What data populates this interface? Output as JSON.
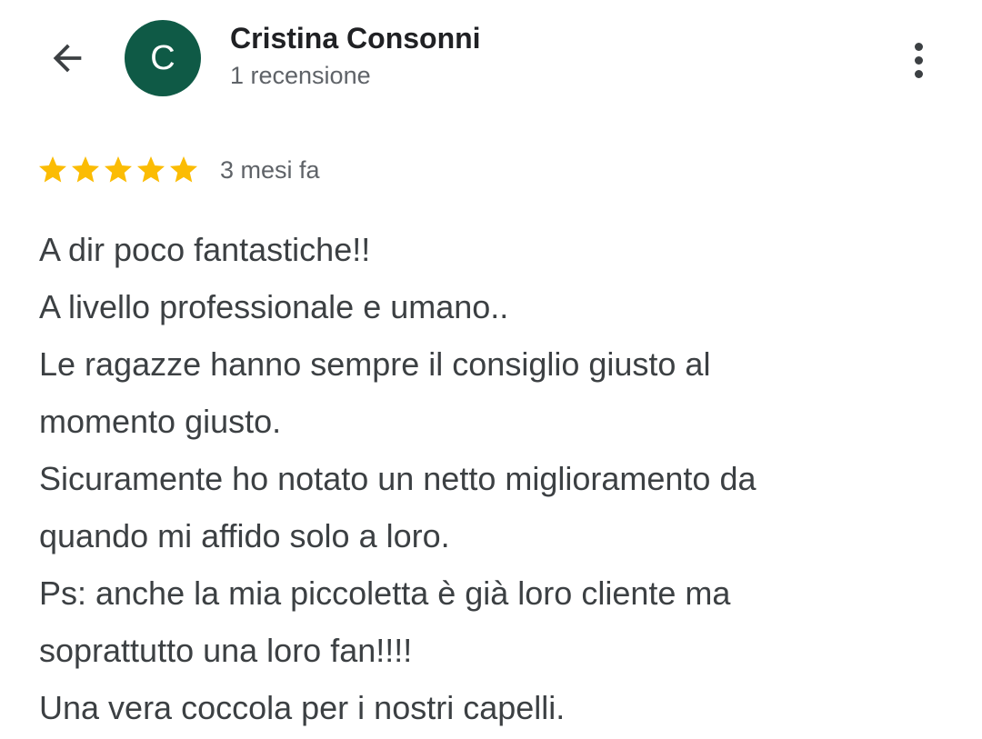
{
  "header": {
    "back_icon": "arrow-back-icon",
    "avatar": {
      "letter": "C",
      "color": "#0f5a46"
    },
    "name": "Cristina Consonni",
    "subtitle": "1 recensione",
    "more_icon": "more-vert-icon"
  },
  "rating": {
    "stars": 5,
    "max_stars": 5,
    "star_color": "#fbbc04",
    "time_ago": "3 mesi fa"
  },
  "review": {
    "lines": [
      "A dir poco fantastiche!!",
      "A livello professionale e umano..",
      "Le ragazze hanno sempre il consiglio giusto al",
      "momento giusto.",
      "Sicuramente ho notato un netto miglioramento da",
      "quando mi affido solo a loro.",
      "Ps: anche la mia piccoletta è già loro cliente ma",
      "soprattutto una loro fan!!!!",
      "Una vera coccola per i nostri capelli."
    ]
  }
}
